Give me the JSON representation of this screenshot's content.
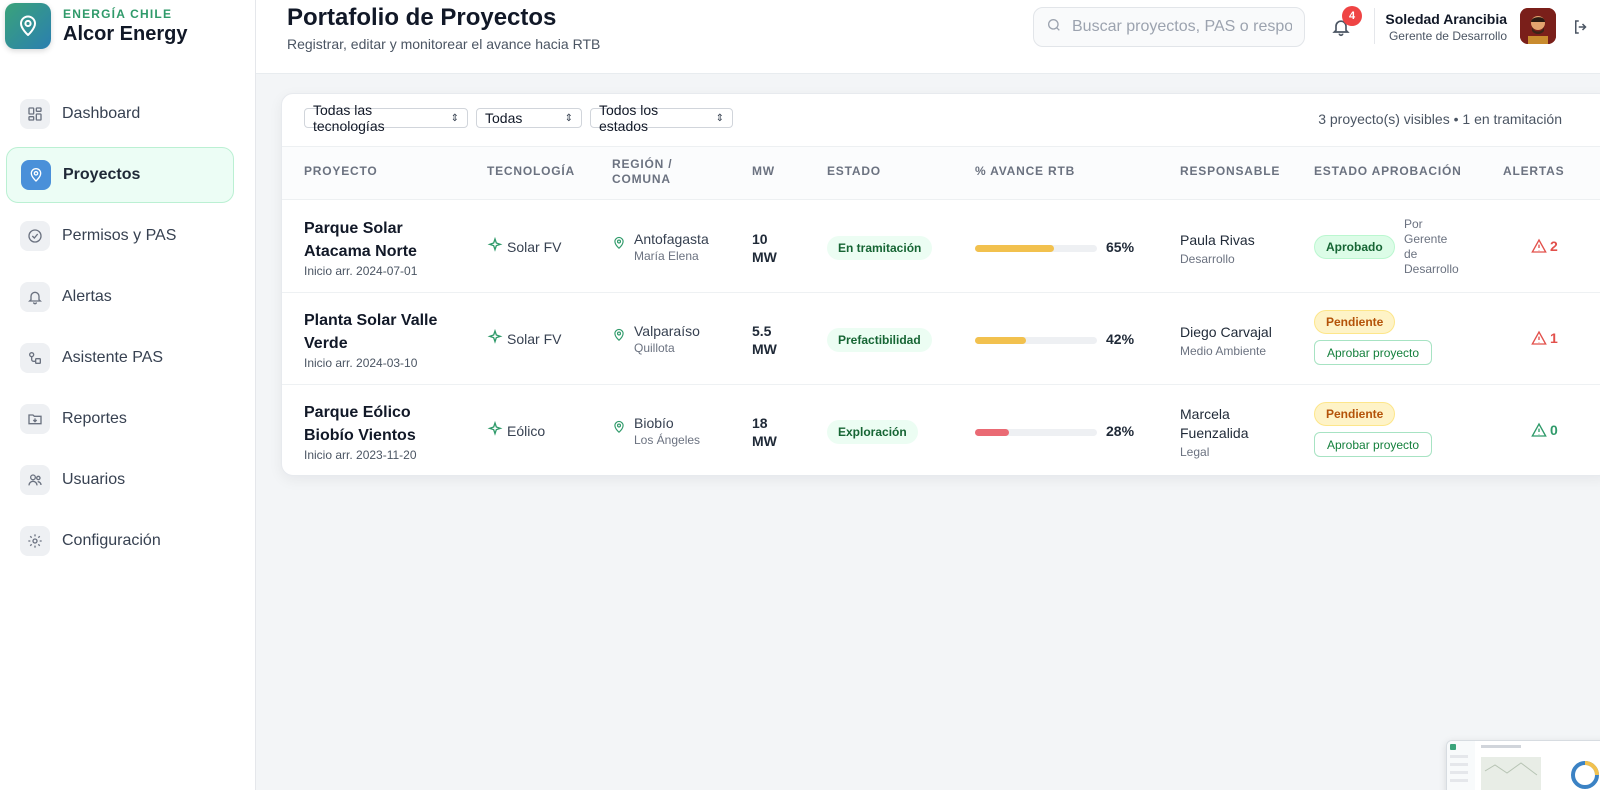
{
  "brand": {
    "sub": "ENERGÍA CHILE",
    "name": "Alcor Energy"
  },
  "nav": [
    {
      "label": "Dashboard",
      "icon": "dashboard-icon"
    },
    {
      "label": "Proyectos",
      "icon": "location-pin-icon",
      "active": true
    },
    {
      "label": "Permisos y PAS",
      "icon": "check-circle-icon"
    },
    {
      "label": "Alertas",
      "icon": "bell-icon"
    },
    {
      "label": "Asistente PAS",
      "icon": "workflow-icon"
    },
    {
      "label": "Reportes",
      "icon": "folder-icon"
    },
    {
      "label": "Usuarios",
      "icon": "users-icon"
    },
    {
      "label": "Configuración",
      "icon": "gear-icon"
    }
  ],
  "header": {
    "title": "Portafolio de Proyectos",
    "subtitle": "Registrar, editar y monitorear el avance hacia RTB",
    "search_placeholder": "Buscar proyectos, PAS o responsables",
    "notifications": "4",
    "user_name": "Soledad Arancibia",
    "user_role": "Gerente de Desarrollo"
  },
  "filters": {
    "technology": "Todas las tecnologías",
    "region": "Todas",
    "status": "Todos los estados",
    "visible_count": "3 proyecto(s) visibles • 1 en tramitación"
  },
  "columns": {
    "project": "PROYECTO",
    "technology": "TECNOLOGÍA",
    "region": "REGIÓN / COMUNA",
    "mw": "MW",
    "status": "ESTADO",
    "progress": "% AVANCE RTB",
    "owner": "RESPONSABLE",
    "approval": "ESTADO APROBACIÓN",
    "alerts": "ALERTAS"
  },
  "rows": [
    {
      "name": "Parque Solar Atacama Norte",
      "start": "Inicio arr. 2024-07-01",
      "technology": "Solar FV",
      "region": "Antofagasta",
      "commune": "María Elena",
      "mw": "10 MW",
      "status": "En tramitación",
      "progress": 0.65,
      "progress_label": "65%",
      "progress_color": "#f2c14e",
      "owner": "Paula Rivas",
      "dept": "Desarrollo",
      "approval": "Aprobado",
      "approval_note": "Por Gerente de Desarrollo",
      "alerts": "2",
      "alert_color": "#e2504b"
    },
    {
      "name": "Planta Solar Valle Verde",
      "start": "Inicio arr. 2024-03-10",
      "technology": "Solar FV",
      "region": "Valparaíso",
      "commune": "Quillota",
      "mw": "5.5 MW",
      "status": "Prefactibilidad",
      "progress": 0.42,
      "progress_label": "42%",
      "progress_color": "#f2c14e",
      "owner": "Diego Carvajal",
      "dept": "Medio Ambiente",
      "approval": "Pendiente",
      "approve_label": "Aprobar proyecto",
      "alerts": "1",
      "alert_color": "#e2504b"
    },
    {
      "name": "Parque Eólico Biobío Vientos",
      "start": "Inicio arr. 2023-11-20",
      "technology": "Eólico",
      "region": "Biobío",
      "commune": "Los Ángeles",
      "mw": "18 MW",
      "status": "Exploración",
      "progress": 0.28,
      "progress_label": "28%",
      "progress_color": "#ea6a74",
      "owner": "Marcela Fuenzalida",
      "dept": "Legal",
      "approval": "Pendiente",
      "approve_label": "Aprobar proyecto",
      "alerts": "0",
      "alert_color": "#2f9a6a"
    }
  ]
}
